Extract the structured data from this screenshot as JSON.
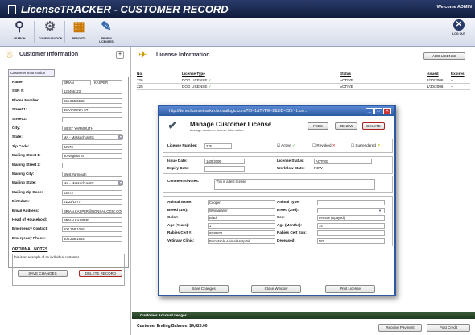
{
  "app": {
    "title": "LicenseTRACKER - CUSTOMER RECORD",
    "welcome": "Welcome ADMIN"
  },
  "toolbar": {
    "items": [
      {
        "label": "SEARCH",
        "icon": "search-icon"
      },
      {
        "label": "CONFIGURATION",
        "icon": "config-icon"
      },
      {
        "label": "REPORTS",
        "icon": "reports-icon"
      },
      {
        "label": "RENEW LICENSES",
        "icon": "renew-icon"
      }
    ],
    "logout": "LOG OUT"
  },
  "customer": {
    "panel_title": "Customer Information",
    "tab": "Customer Information",
    "fields": [
      {
        "label": "Name:",
        "value": "BRIAN",
        "value2": "KASPER"
      },
      {
        "label": "SSN #:",
        "value": "123456123"
      },
      {
        "label": "Phone Number:",
        "value": "555.555.5555"
      },
      {
        "label": "Street 1:",
        "value": "30 VIRGINIA ST"
      },
      {
        "label": "Street 2:",
        "value": ""
      },
      {
        "label": "City:",
        "value": "WEST YARMOUTH"
      },
      {
        "label": "State:",
        "value": "MA - Massachusetts",
        "select": true
      },
      {
        "label": "Zip Code:",
        "value": "02673"
      },
      {
        "label": "Mailing Street 1:",
        "value": "30 Virginia St"
      },
      {
        "label": "Mailing Street 2:",
        "value": ""
      },
      {
        "label": "Mailing City:",
        "value": "West Yarmouth"
      },
      {
        "label": "Mailing State:",
        "value": "MA - Massachusetts",
        "select": true
      },
      {
        "label": "Mailing Zip Code:",
        "value": "02673"
      },
      {
        "label": "Birthdate:",
        "value": "01/23/1977"
      },
      {
        "label": "Email Address:",
        "value": "BRIAN.KASPER@BONSAILOGIC.COM"
      },
      {
        "label": "Head of Household:",
        "value": "BRIAN KASPER"
      },
      {
        "label": "Emergency Contact:",
        "value": "508.258.1016"
      },
      {
        "label": "Emergency Phone:",
        "value": "508.258.1683"
      }
    ],
    "optional_notes_title": "OPTIONAL NOTES",
    "optional_notes": "this is an example of an individual customer",
    "save_button": "SAVE CHANGES",
    "delete_button": "DELETE RECORD"
  },
  "licenses": {
    "panel_title": "License Information",
    "add_button": "ADD LICENSE",
    "columns": [
      "No.",
      "License Type",
      "Status",
      "Issued",
      "Expires"
    ],
    "rows": [
      {
        "no": "226",
        "type": "DOG LICENSE",
        "status": "ACTIVE",
        "issued": "2/20/2006",
        "expires": "--"
      },
      {
        "no": "225",
        "type": "DOG LICENSE",
        "status": "ACTIVE",
        "issued": "1/30/2006",
        "expires": "--"
      }
    ]
  },
  "modal": {
    "window_title": "http://demo.licensetracker.bonsailogic.com/?ID=1&TYPE=2&LID=225 - Lice...",
    "title": "Manage Customer License",
    "subtitle": "Manage customer license information",
    "buttons": {
      "fees": "FEES",
      "renew": "RENEW",
      "delete": "DELETE"
    },
    "license_number_label": "License Number:",
    "license_number": "225",
    "active_label": "Active",
    "revoked_label": "Revoked",
    "surrendered_label": "Surrendered",
    "issue_date_label": "Issue Date:",
    "issue_date": "1/30/2006",
    "expiry_date_label": "Expiry Date:",
    "expiry_date": "",
    "license_status_label": "License Status:",
    "license_status": "ACTIVE",
    "workflow_state_label": "Workflow State:",
    "workflow_state": "NEW",
    "comments_label": "Comments/Notes:",
    "comments": "This is a test license",
    "animal": {
      "left": [
        {
          "label": "Animal Name:",
          "value": "Cooper"
        },
        {
          "label": "Breed (1st):",
          "value": "Weimaraner"
        },
        {
          "label": "Color:",
          "value": "Black"
        },
        {
          "label": "Age (Years):",
          "value": "1"
        },
        {
          "label": "Rabies Cert #:",
          "value": "6549876"
        },
        {
          "label": "Vetinary Clinic:",
          "value": "Barnstable Animal Hospital"
        }
      ],
      "right": [
        {
          "label": "Animal Type:",
          "value": ""
        },
        {
          "label": "Breed (2nd):",
          "value": "",
          "select": true
        },
        {
          "label": "Sex:",
          "value": "Female (Spayed)"
        },
        {
          "label": "Age (Months):",
          "value": "14"
        },
        {
          "label": "Rabies Cert Exp:",
          "value": ""
        },
        {
          "label": "Deceased:",
          "value": "NO"
        }
      ]
    },
    "save_button": "Save Changes",
    "close_button": "Close Window",
    "print_button": "Print License"
  },
  "ledger": {
    "title": "Customer Account Ledger",
    "balance_label": "Customer Ending Balance:",
    "balance": "$4,825.00",
    "receive_payment": "Receive Payment",
    "post_credit": "Post Credit"
  },
  "colors": {
    "header": "#1a2850",
    "modal_border": "#2c5aa0",
    "ledger": "#2a4a2a",
    "delete_accent": "#aa2222"
  }
}
